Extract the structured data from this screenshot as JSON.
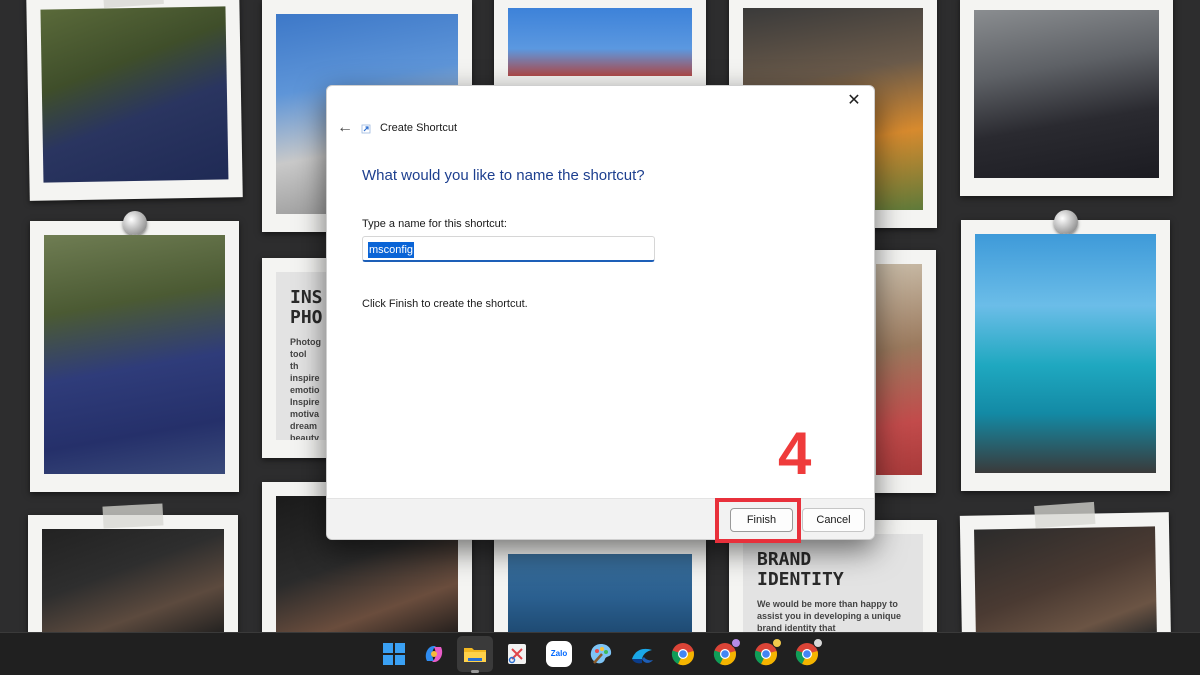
{
  "dialog": {
    "title": "Create Shortcut",
    "heading": "What would you like to name the shortcut?",
    "name_label": "Type a name for this shortcut:",
    "name_value": "msconfig",
    "hint": "Click Finish to create the shortcut.",
    "finish_label": "Finish",
    "cancel_label": "Cancel",
    "close_glyph": "✕",
    "back_glyph": "←"
  },
  "annotation": {
    "step_number": "4",
    "color": "#e8303b"
  },
  "wallpaper": {
    "card1": {
      "title_line1": "INS",
      "title_line2": "PHO",
      "body": "Photog tool th inspire emotio Inspire motiva dream beauty hope in"
    },
    "card2": {
      "title_line1": "BRAND",
      "title_line2": "IDENTITY",
      "body": "We would be more than happy to assist you in developing a unique brand identity that"
    }
  },
  "taskbar": {
    "zalo_label": "Zalo",
    "icons": [
      "windows-start-icon",
      "copilot-icon",
      "file-explorer-icon",
      "snipping-tool-icon",
      "zalo-icon",
      "paint-icon",
      "edge-icon",
      "chrome-icon",
      "chrome-profile-icon",
      "chrome-profile-icon",
      "chrome-profile-icon"
    ]
  }
}
